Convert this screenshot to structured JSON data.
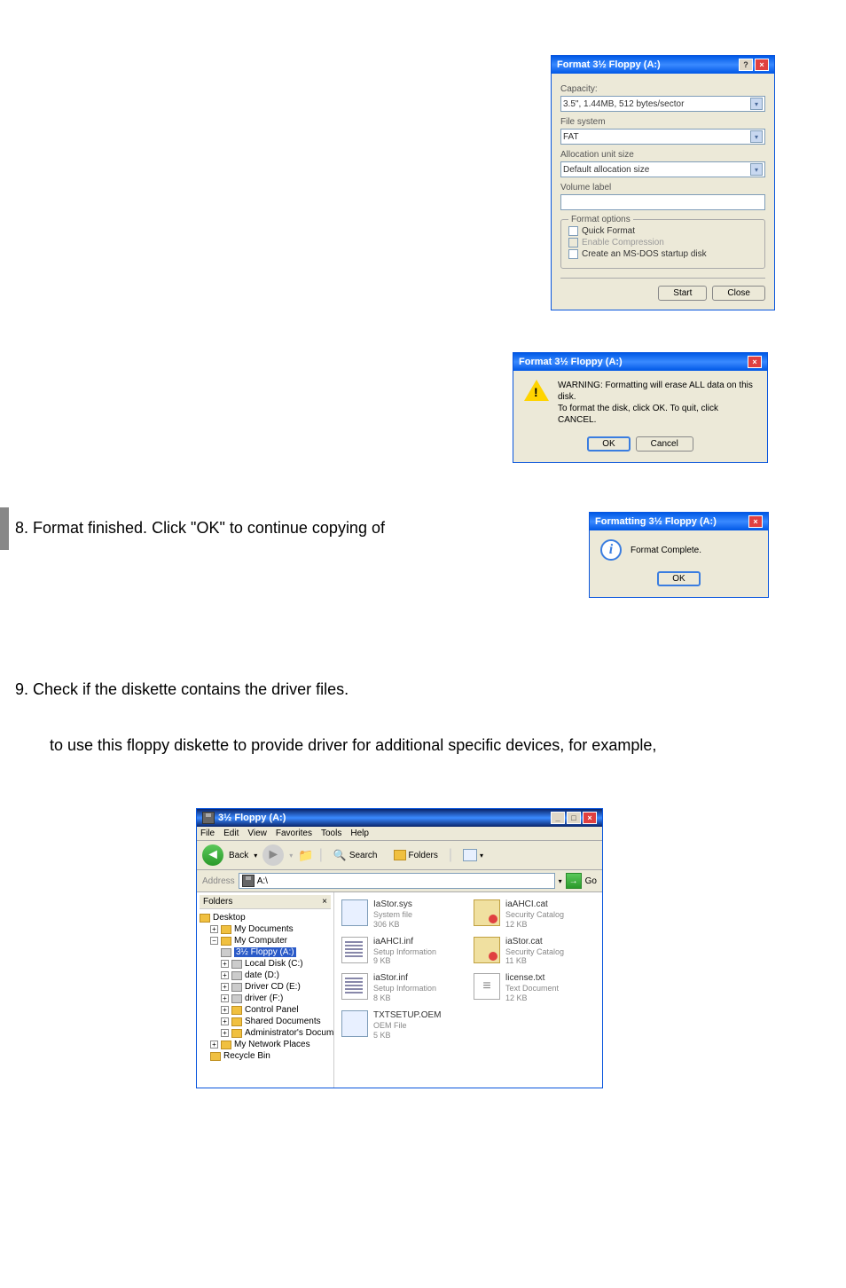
{
  "formatDialog": {
    "title": "Format 3½ Floppy (A:)",
    "capacityLabel": "Capacity:",
    "capacityValue": "3.5\", 1.44MB, 512 bytes/sector",
    "fileSystemLabel": "File system",
    "fileSystemValue": "FAT",
    "allocLabel": "Allocation unit size",
    "allocValue": "Default allocation size",
    "volumeLabel": "Volume label",
    "optionsLegend": "Format options",
    "quickFormat": "Quick Format",
    "enableCompression": "Enable Compression",
    "createStartup": "Create an MS-DOS startup disk",
    "startBtn": "Start",
    "closeBtn": "Close"
  },
  "warnDialog": {
    "title": "Format 3½ Floppy (A:)",
    "line1": "WARNING: Formatting will erase ALL data on this disk.",
    "line2": "To format the disk, click OK. To quit, click CANCEL.",
    "okBtn": "OK",
    "cancelBtn": "Cancel"
  },
  "step8": "8. Format finished. Click \"OK\" to continue copying of",
  "completeDialog": {
    "title": "Formatting 3½ Floppy (A:)",
    "message": "Format Complete.",
    "okBtn": "OK"
  },
  "step9": "9. Check if the diskette contains the driver files.",
  "step9sub": "to use this floppy diskette to provide driver for additional specific devices, for example,",
  "explorer": {
    "title": "3½ Floppy (A:)",
    "menus": [
      "File",
      "Edit",
      "View",
      "Favorites",
      "Tools",
      "Help"
    ],
    "backLabel": "Back",
    "searchLabel": "Search",
    "foldersLabel": "Folders",
    "addressLabel": "Address",
    "addressValue": "A:\\",
    "goLabel": "Go",
    "foldersHeader": "Folders",
    "tree": {
      "desktop": "Desktop",
      "mydocs": "My Documents",
      "mycomp": "My Computer",
      "floppy": "3½ Floppy (A:)",
      "localc": "Local Disk (C:)",
      "dated": "date (D:)",
      "drivere": "Driver CD (E:)",
      "driverf": "driver (F:)",
      "control": "Control Panel",
      "shared": "Shared Documents",
      "admin": "Administrator's Documents",
      "network": "My Network Places",
      "recycle": "Recycle Bin"
    },
    "files": [
      {
        "name": "IaStor.sys",
        "type": "System file",
        "size": "306 KB",
        "icon": "sys"
      },
      {
        "name": "iaAHCI.cat",
        "type": "Security Catalog",
        "size": "12 KB",
        "icon": "cat"
      },
      {
        "name": "iaAHCI.inf",
        "type": "Setup Information",
        "size": "9 KB",
        "icon": "inf"
      },
      {
        "name": "iaStor.cat",
        "type": "Security Catalog",
        "size": "11 KB",
        "icon": "cat"
      },
      {
        "name": "iaStor.inf",
        "type": "Setup Information",
        "size": "8 KB",
        "icon": "inf"
      },
      {
        "name": "license.txt",
        "type": "Text Document",
        "size": "12 KB",
        "icon": "txt"
      },
      {
        "name": "TXTSETUP.OEM",
        "type": "OEM File",
        "size": "5 KB",
        "icon": "oem"
      }
    ]
  }
}
